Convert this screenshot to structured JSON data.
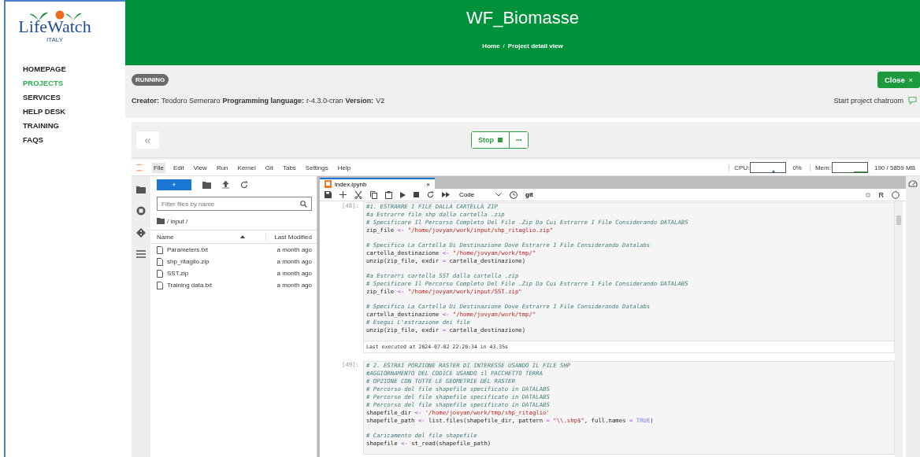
{
  "logo": {
    "name": "LifeWatch",
    "country": "ITALY"
  },
  "nav": [
    {
      "label": "HOMEPAGE",
      "selected": false
    },
    {
      "label": "PROJECTS",
      "selected": true
    },
    {
      "label": "SERVICES",
      "selected": false
    },
    {
      "label": "HELP DESK",
      "selected": false
    },
    {
      "label": "TRAINING",
      "selected": false
    },
    {
      "label": "FAQS",
      "selected": false
    }
  ],
  "header": {
    "title": "WF_Biomasse",
    "breadcrumb": [
      {
        "label": "Home",
        "kind": "link"
      },
      {
        "label": "/",
        "kind": "separator"
      },
      {
        "label": "Project detail view",
        "kind": "current"
      }
    ]
  },
  "project": {
    "status": "RUNNING",
    "close_label": "Close",
    "close_icon": "×",
    "details": [
      {
        "label": "Creator:",
        "value": "Teodoro Semeraro"
      },
      {
        "label": "Programming language:",
        "value": "r-4.3.0-cran"
      },
      {
        "label": "Version:",
        "value": "V2"
      }
    ],
    "chatroom": "Start project chatroom"
  },
  "session": {
    "collapse": "«",
    "stop_label": "Stop",
    "more": "•••"
  },
  "jupyter": {
    "menu": [
      {
        "label": "File",
        "selected": true
      },
      {
        "label": "Edit",
        "selected": false
      },
      {
        "label": "View",
        "selected": false
      },
      {
        "label": "Run",
        "selected": false
      },
      {
        "label": "Kernel",
        "selected": false
      },
      {
        "label": "Git",
        "selected": false
      },
      {
        "label": "Tabs",
        "selected": false
      },
      {
        "label": "Settings",
        "selected": false
      },
      {
        "label": "Help",
        "selected": false
      }
    ],
    "cpu_label": "CPU:",
    "cpu_reading": "0%",
    "mem_label": "Mem:",
    "mem_reading": "190 / 5859 MB",
    "files": {
      "new_label": "+",
      "filter_placeholder": "Filter files by name",
      "path": "/ input /",
      "columns": [
        "Name",
        "Last Modified"
      ],
      "rows": [
        {
          "name": "Parameters.txt",
          "modified": "a month ago"
        },
        {
          "name": "shp_ritaglio.zip",
          "modified": "a month ago"
        },
        {
          "name": "SST.zip",
          "modified": "a month ago"
        },
        {
          "name": "Training data.txt",
          "modified": "a month ago"
        }
      ]
    },
    "notebook": {
      "tab": "index.ipynb",
      "tab_close": "×",
      "cell_type": "Code",
      "git": "git",
      "kernel": "R",
      "cells": [
        {
          "prompt": "[48]:",
          "executed": "Last executed at 2024-07-02 22:20:34 in 43.35s",
          "lines": [
            {
              "tokens": [
                {
                  "kind": "comment",
                  "text": "#1. ESTRARRE I FILE DALLA CARTELLA ZIP"
                }
              ]
            },
            {
              "tokens": [
                {
                  "kind": "comment",
                  "text": "#a Estrarre file shp dalla cartella .zip"
                }
              ]
            },
            {
              "tokens": [
                {
                  "kind": "comment",
                  "text": "# Specificare Il Percorso Completo Del File .Zip Da Cui Estrarre I File Considerando DATALABS"
                }
              ]
            },
            {
              "tokens": [
                {
                  "kind": "code",
                  "text": "zip_file "
                },
                {
                  "kind": "operator",
                  "text": "<-"
                },
                {
                  "kind": "string",
                  "text": " \"/home/jovyan/work/input/shp_ritaglio.zip\""
                }
              ]
            },
            {
              "gap_before": true,
              "tokens": [
                {
                  "kind": "comment",
                  "text": "# Specifica La Cartella Di Destinazione Dove Estrarre I File Considerando Datalabs"
                }
              ]
            },
            {
              "tokens": [
                {
                  "kind": "code",
                  "text": "cartella_destinazione "
                },
                {
                  "kind": "operator",
                  "text": "<-"
                },
                {
                  "kind": "string",
                  "text": " \"/home/jovyan/work/tmp/\""
                }
              ]
            },
            {
              "tokens": [
                {
                  "kind": "code",
                  "text": "unzip(zip_file, exdir "
                },
                {
                  "kind": "operator",
                  "text": "="
                },
                {
                  "kind": "code",
                  "text": " cartella_destinazione)"
                }
              ]
            },
            {
              "gap_before": true,
              "tokens": [
                {
                  "kind": "comment",
                  "text": "#a Estrarri cartella SST dalla cartella .zip"
                }
              ]
            },
            {
              "tokens": [
                {
                  "kind": "comment",
                  "text": "# Specificare Il Percorso Completo Del File .Zip Da Cui Estrarre I File Considerando DATALABS"
                }
              ]
            },
            {
              "tokens": [
                {
                  "kind": "code",
                  "text": "zip_file "
                },
                {
                  "kind": "operator",
                  "text": "<-"
                },
                {
                  "kind": "string",
                  "text": " \"/home/jovyan/work/input/SST.zip\""
                }
              ]
            },
            {
              "gap_before": true,
              "tokens": [
                {
                  "kind": "comment",
                  "text": "# Specifica La Cartella Di Destinazione Dove Estrarre I File Considerando Datalabs"
                }
              ]
            },
            {
              "tokens": [
                {
                  "kind": "code",
                  "text": "cartella_destinazione "
                },
                {
                  "kind": "operator",
                  "text": "<-"
                },
                {
                  "kind": "string",
                  "text": " \"/home/jovyan/work/tmp/\""
                }
              ]
            },
            {
              "tokens": [
                {
                  "kind": "comment",
                  "text": "# Esegui L'estrazione dei file"
                }
              ]
            },
            {
              "tokens": [
                {
                  "kind": "code",
                  "text": "unzip(zip_file, exdir "
                },
                {
                  "kind": "operator",
                  "text": "="
                },
                {
                  "kind": "code",
                  "text": " cartella_destinazione)"
                }
              ]
            }
          ]
        },
        {
          "prompt": "[49]:",
          "lines": [
            {
              "tokens": [
                {
                  "kind": "comment",
                  "text": "# 2. ESTRAI PORZIONE RASTER DI INTERESSE USANDO IL FILE SHP"
                }
              ]
            },
            {
              "tokens": [
                {
                  "kind": "comment",
                  "text": "#AGGIORNAMENTO DEL CODICE USANDO il PACCHETTO TERRA"
                }
              ]
            },
            {
              "tokens": [
                {
                  "kind": "comment",
                  "text": "# OPZIONE CON TUTTE LE GEOMETRIE DEL RASTER"
                }
              ]
            },
            {
              "tokens": [
                {
                  "kind": "comment",
                  "text": "# Percorso del file shapefile specificato in DATALABS"
                }
              ]
            },
            {
              "tokens": [
                {
                  "kind": "comment",
                  "text": "# Percorso del file shapefile specificato in DATALABS"
                }
              ]
            },
            {
              "tokens": [
                {
                  "kind": "comment",
                  "text": "# Percorso del file shapefile specificato in DATALABS"
                }
              ]
            },
            {
              "tokens": [
                {
                  "kind": "code",
                  "text": "shapefile_dir "
                },
                {
                  "kind": "operator",
                  "text": "<-"
                },
                {
                  "kind": "string",
                  "text": " '/home/jovyan/work/tmp/shp_ritaglio'"
                }
              ]
            },
            {
              "tokens": [
                {
                  "kind": "code",
                  "text": "shapefile_path "
                },
                {
                  "kind": "operator",
                  "text": "<-"
                },
                {
                  "kind": "code",
                  "text": " list.files(shapefile_dir, pattern "
                },
                {
                  "kind": "operator",
                  "text": "="
                },
                {
                  "kind": "string",
                  "text": " \"\\\\.shp$\""
                },
                {
                  "kind": "code",
                  "text": ", full.names "
                },
                {
                  "kind": "operator",
                  "text": "="
                },
                {
                  "kind": "constant",
                  "text": " TRUE"
                },
                {
                  "kind": "code",
                  "text": ")"
                }
              ]
            },
            {
              "gap_before": true,
              "tokens": [
                {
                  "kind": "comment",
                  "text": "# Caricamento del file shapefile"
                }
              ]
            },
            {
              "tokens": [
                {
                  "kind": "code",
                  "text": "shapefile "
                },
                {
                  "kind": "operator",
                  "text": "<-"
                },
                {
                  "kind": "code",
                  "text": " st_read(shapefile_path)"
                }
              ]
            }
          ]
        }
      ]
    }
  }
}
